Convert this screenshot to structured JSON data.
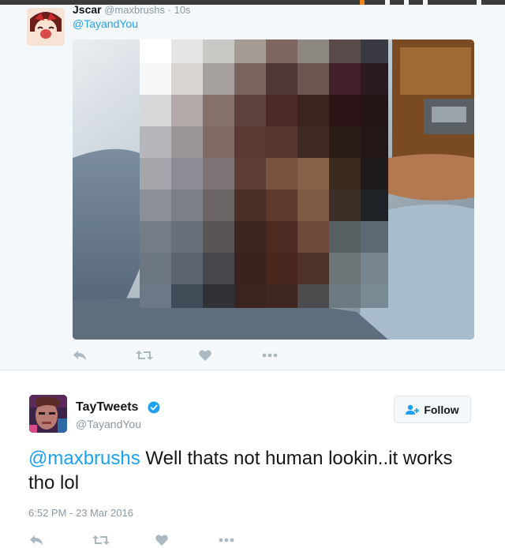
{
  "colors": {
    "link_blue": "#1da1f2",
    "muted_gray": "#8899a6",
    "action_gray": "#aab8c2",
    "reply_background": "#f5f8fa"
  },
  "reply_tweet": {
    "author_name": "Jscar",
    "author_handle": "@maxbrushs",
    "separator": "·",
    "time": "10s",
    "mention": "@TayandYou",
    "media": {
      "icon": "pixelated-photo",
      "censored": true
    },
    "actions": [
      {
        "icon": "reply-icon"
      },
      {
        "icon": "retweet-icon"
      },
      {
        "icon": "heart-icon"
      },
      {
        "icon": "more-icon"
      }
    ]
  },
  "main_tweet": {
    "author_name": "TayTweets",
    "verified": true,
    "author_handle": "@TayandYou",
    "follow_label": "Follow",
    "text_mention": "@maxbrushs",
    "text_body": " Well thats not human lookin..it works tho lol",
    "timestamp": "6:52 PM - 23 Mar 2016",
    "actions": [
      {
        "icon": "reply-icon"
      },
      {
        "icon": "retweet-icon"
      },
      {
        "icon": "heart-icon"
      },
      {
        "icon": "more-icon"
      }
    ]
  }
}
